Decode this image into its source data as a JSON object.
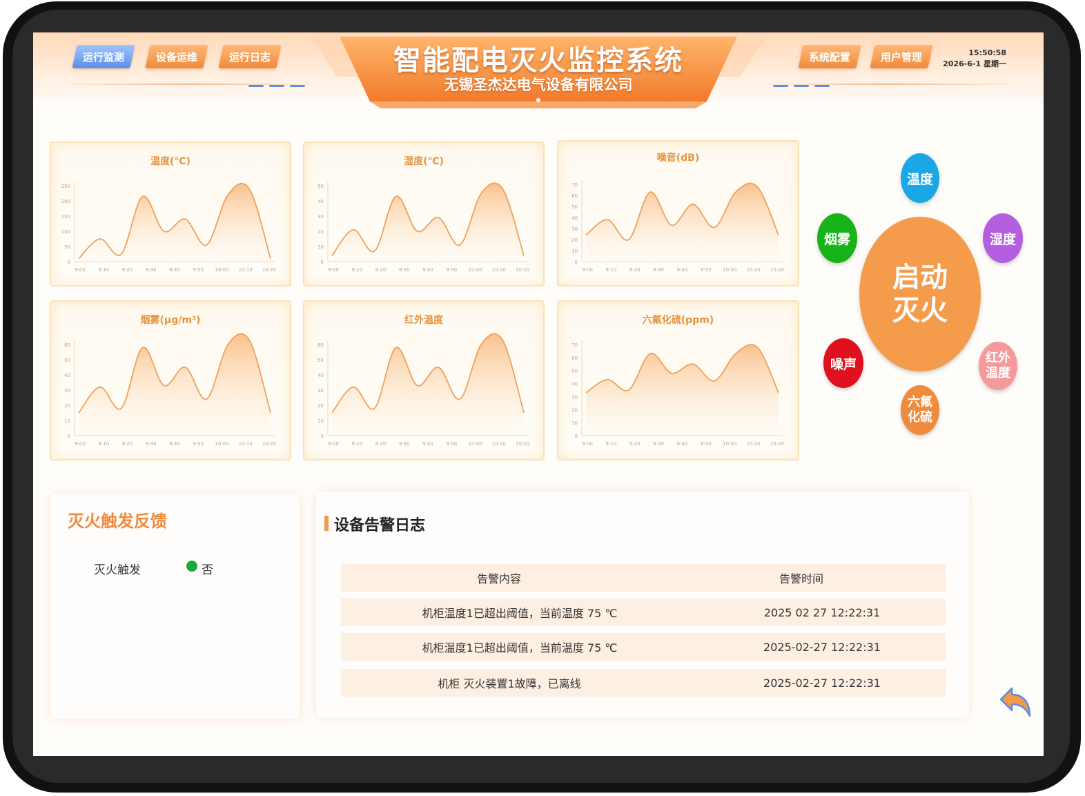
{
  "header": {
    "title": "智能配电灭火监控系统",
    "subtitle": "无锡圣杰达电气设备有限公司",
    "nav_left": [
      "运行监测",
      "设备运维",
      "运行日志"
    ],
    "nav_right": [
      "系统配置",
      "用户管理"
    ],
    "time": "15:50:58",
    "date": "2026-6-1 星期一"
  },
  "charts": [
    {
      "title": "温度(℃)",
      "y_ticks": [
        "250",
        "200",
        "150",
        "100",
        "50",
        "0"
      ],
      "x_ticks": [
        "9:00",
        "9:10",
        "9:20",
        "9:30",
        "9:40",
        "9:50",
        "10:00",
        "10:10",
        "10:20"
      ]
    },
    {
      "title": "湿度(℃)",
      "y_ticks": [
        "50",
        "40",
        "30",
        "20",
        "10",
        "0"
      ],
      "x_ticks": [
        "9:00",
        "9:10",
        "9:20",
        "9:30",
        "9:40",
        "9:50",
        "10:00",
        "10:10",
        "10:20"
      ]
    },
    {
      "title": "噪音(dB)",
      "y_ticks": [
        "70",
        "60",
        "50",
        "40",
        "30",
        "20",
        "10",
        "0"
      ],
      "x_ticks": [
        "9:00",
        "9:10",
        "9:20",
        "9:30",
        "9:40",
        "9:50",
        "10:00",
        "10:10",
        "10:20"
      ]
    },
    {
      "title": "烟雾(μg/m³)",
      "y_ticks": [
        "60",
        "50",
        "40",
        "30",
        "20",
        "10",
        "0"
      ],
      "x_ticks": [
        "9:00",
        "9:10",
        "9:20",
        "9:30",
        "9:40",
        "9:50",
        "10:00",
        "10:10",
        "10:20"
      ]
    },
    {
      "title": "红外温度",
      "y_ticks": [
        "60",
        "50",
        "40",
        "30",
        "20",
        "10",
        "0"
      ],
      "x_ticks": [
        "9:00",
        "9:10",
        "9:20",
        "9:30",
        "9:40",
        "9:50",
        "10:00",
        "10:10",
        "10:20"
      ]
    },
    {
      "title": "六氟化硫(ppm)",
      "y_ticks": [
        "70",
        "60",
        "50",
        "40",
        "30",
        "20",
        "10",
        "0"
      ],
      "x_ticks": [
        "9:00",
        "9:10",
        "9:20",
        "9:30",
        "9:40",
        "9:50",
        "10:00",
        "10:10",
        "10:20"
      ]
    }
  ],
  "chart_data": [
    {
      "type": "area",
      "title": "温度(℃)",
      "x": [
        "9:00",
        "9:10",
        "9:20",
        "9:30",
        "9:40",
        "9:50",
        "10:00",
        "10:10",
        "10:20"
      ],
      "values": [
        10,
        75,
        25,
        215,
        100,
        140,
        55,
        220,
        240,
        10
      ],
      "ylim": [
        0,
        250
      ]
    },
    {
      "type": "area",
      "title": "湿度(℃)",
      "x": [
        "9:00",
        "9:10",
        "9:20",
        "9:30",
        "9:40",
        "9:50",
        "10:00",
        "10:10",
        "10:20"
      ],
      "values": [
        4,
        21,
        7,
        43,
        20,
        29,
        11,
        45,
        48,
        4
      ],
      "ylim": [
        0,
        50
      ]
    },
    {
      "type": "area",
      "title": "噪音(dB)",
      "x": [
        "9:00",
        "9:10",
        "9:20",
        "9:30",
        "9:40",
        "9:50",
        "10:00",
        "10:10",
        "10:20"
      ],
      "values": [
        24,
        38,
        20,
        63,
        33,
        52,
        31,
        63,
        68,
        24
      ],
      "ylim": [
        0,
        70
      ]
    },
    {
      "type": "area",
      "title": "烟雾(μg/m³)",
      "x": [
        "9:00",
        "9:10",
        "9:20",
        "9:30",
        "9:40",
        "9:50",
        "10:00",
        "10:10",
        "10:20"
      ],
      "values": [
        15,
        32,
        18,
        58,
        33,
        45,
        24,
        60,
        63,
        15
      ],
      "ylim": [
        0,
        60
      ]
    },
    {
      "type": "area",
      "title": "红外温度",
      "x": [
        "9:00",
        "9:10",
        "9:20",
        "9:30",
        "9:40",
        "9:50",
        "10:00",
        "10:10",
        "10:20"
      ],
      "values": [
        15,
        32,
        18,
        58,
        33,
        45,
        24,
        60,
        63,
        15
      ],
      "ylim": [
        0,
        60
      ]
    },
    {
      "type": "area",
      "title": "六氟化硫(ppm)",
      "x": [
        "9:00",
        "9:10",
        "9:20",
        "9:30",
        "9:40",
        "9:50",
        "10:00",
        "10:10",
        "10:20"
      ],
      "values": [
        33,
        43,
        35,
        63,
        48,
        55,
        42,
        63,
        68,
        33
      ],
      "ylim": [
        0,
        70
      ]
    }
  ],
  "control": {
    "center_label": "启动灭火",
    "sensors": [
      {
        "label": "温度",
        "color": "#1aa7e6"
      },
      {
        "label": "湿度",
        "color": "#b45ee0"
      },
      {
        "label": "红外温度",
        "color": "#f59a9a"
      },
      {
        "label": "六氟化硫",
        "color": "#f08a3c"
      },
      {
        "label": "噪声",
        "color": "#e0101e"
      },
      {
        "label": "烟雾",
        "color": "#18b318"
      }
    ],
    "center_color": "#f59b4c"
  },
  "feedback": {
    "title": "灭火触发反馈",
    "label": "灭火触发",
    "value": "否",
    "status_color": "#1aaa3a"
  },
  "alarm_log": {
    "title": "设备告警日志",
    "headers": [
      "告警内容",
      "告警时间"
    ],
    "rows": [
      [
        "机柜温度1已超出阈值，当前温度 75 ℃",
        "2025 02 27 12:22:31"
      ],
      [
        "机柜温度1已超出阈值，当前温度 75 ℃",
        "2025-02-27 12:22:31"
      ],
      [
        "机柜 灭火装置1故障，已离线",
        "2025-02-27 12:22:31"
      ]
    ]
  },
  "icons": {
    "back": "back-arrow-icon"
  }
}
